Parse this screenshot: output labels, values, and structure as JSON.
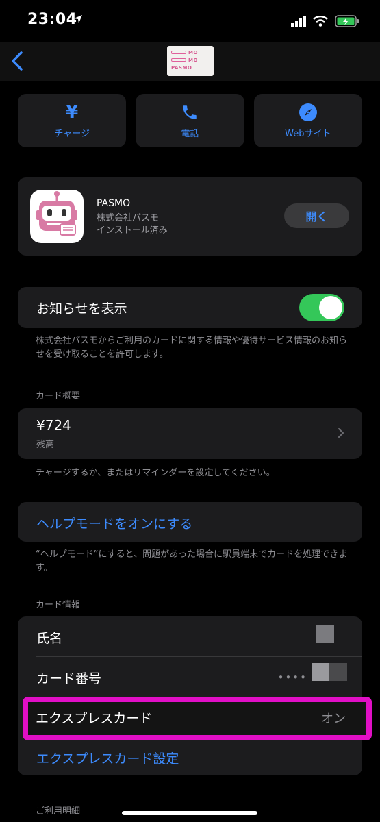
{
  "status": {
    "time": "23:04"
  },
  "nav": {
    "card_line1": "MO",
    "card_line2": "MO",
    "card_line3": "PASMO"
  },
  "actions": [
    {
      "label": "チャージ",
      "icon": "yen-icon"
    },
    {
      "label": "電話",
      "icon": "phone-icon"
    },
    {
      "label": "Webサイト",
      "icon": "compass-icon"
    }
  ],
  "app": {
    "name": "PASMO",
    "company": "株式会社パスモ",
    "status": "インストール済み",
    "open_label": "開く"
  },
  "notifications": {
    "label": "お知らせを表示",
    "enabled": true,
    "footnote": "株式会社パスモからご利用のカードに関する情報や優待サービス情報のお知らせを受け取ることを許可します。"
  },
  "summary": {
    "header": "カード概要",
    "balance": "¥724",
    "balance_caption": "残高",
    "footnote": "チャージするか、またはリマインダーを設定してください。"
  },
  "help": {
    "label": "ヘルプモードをオンにする",
    "footnote": "“ヘルプモード”にすると、問題があった場合に駅員端末でカードを処理できます。"
  },
  "card_info": {
    "header": "カード情報",
    "name_label": "氏名",
    "number_label": "カード番号",
    "number_dots": "••••",
    "express_label": "エクスプレスカード",
    "express_value": "オン",
    "express_settings": "エクスプレスカード設定"
  },
  "history": {
    "header": "ご利用明細"
  },
  "colors": {
    "accent": "#3d8bfd",
    "toggle_on": "#34c759",
    "highlight": "#e10fc6"
  }
}
